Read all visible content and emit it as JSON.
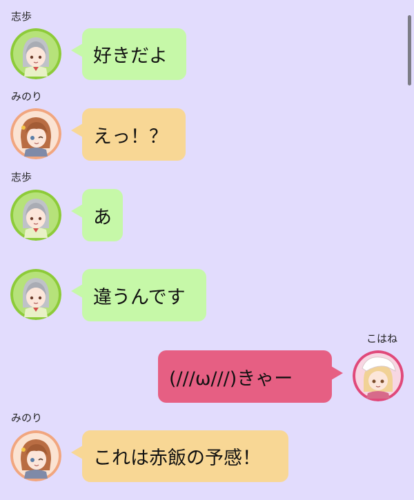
{
  "colors": {
    "background": "#E2DCFD",
    "green_bubble": "#C6F8A8",
    "orange_bubble": "#F8D795",
    "pink_bubble": "#E65F83",
    "green_avatar_ring": "#8DCB39",
    "orange_avatar_ring": "#F1A67F",
    "pink_avatar_ring": "#E0497A"
  },
  "messages": [
    {
      "sender": "志歩",
      "text": "好きだよ",
      "avatar": "shiho-avatar-icon"
    },
    {
      "sender": "みのり",
      "text": "えっ！？",
      "avatar": "minori-avatar-icon"
    },
    {
      "sender": "志歩",
      "text": "あ",
      "avatar": "shiho-avatar-icon"
    },
    {
      "sender": "",
      "text": "違うんです",
      "avatar": "shiho-avatar-icon"
    },
    {
      "sender": "こはね",
      "text": "(///ω///)きゃー",
      "avatar": "kohane-avatar-icon"
    },
    {
      "sender": "みのり",
      "text": "これは赤飯の予感！",
      "avatar": "minori-avatar-icon"
    }
  ]
}
